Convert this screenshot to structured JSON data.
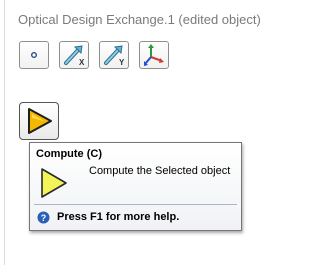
{
  "window": {
    "title": "Optical Design Exchange.1 (edited object)"
  },
  "toolbar": {
    "items": [
      {
        "icon": "point-icon"
      },
      {
        "icon": "axis-x-icon",
        "letter": "X"
      },
      {
        "icon": "axis-y-icon",
        "letter": "Y"
      },
      {
        "icon": "axis-system-icon"
      }
    ]
  },
  "compute": {
    "icon": "compute-triangle-icon"
  },
  "tooltip": {
    "title": "Compute (C)",
    "description": "Compute the Selected object",
    "help": "Press F1 for more help."
  }
}
